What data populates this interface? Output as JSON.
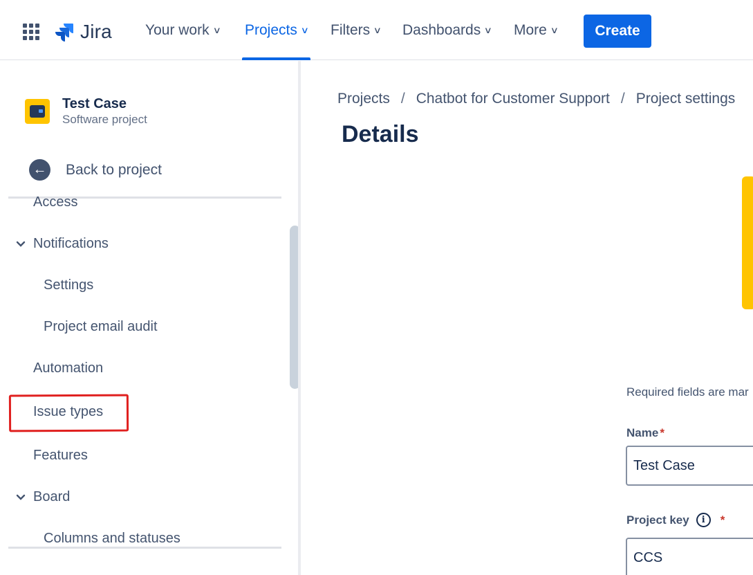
{
  "topnav": {
    "app_name": "Jira",
    "items": [
      {
        "label": "Your work",
        "active": false
      },
      {
        "label": "Projects",
        "active": true
      },
      {
        "label": "Filters",
        "active": false
      },
      {
        "label": "Dashboards",
        "active": false
      },
      {
        "label": "More",
        "active": false
      }
    ],
    "create_label": "Create",
    "colors": {
      "accent": "#0c66e4",
      "text": "#42526e"
    }
  },
  "sidebar": {
    "project_name": "Test Case",
    "project_type": "Software project",
    "back_label": "Back to project",
    "items": [
      {
        "label": "Access",
        "expandable": false
      },
      {
        "label": "Notifications",
        "expandable": true
      },
      {
        "label": "Settings",
        "expandable": false
      },
      {
        "label": "Project email audit",
        "expandable": false
      },
      {
        "label": "Automation",
        "expandable": false
      },
      {
        "label": "Issue types",
        "expandable": false,
        "highlighted": true
      },
      {
        "label": "Features",
        "expandable": false
      },
      {
        "label": "Board",
        "expandable": true
      },
      {
        "label": "Columns and statuses",
        "expandable": false
      }
    ]
  },
  "main": {
    "breadcrumb": [
      "Projects",
      "Chatbot for Customer Support",
      "Project settings"
    ],
    "breadcrumb_separator": "/",
    "title": "Details",
    "required_note": "Required fields are mar",
    "fields": {
      "name": {
        "label": "Name",
        "value": "Test Case",
        "required_mark": "*"
      },
      "project_key": {
        "label": "Project key",
        "value": "CCS",
        "required_mark": "*",
        "info_icon": "i"
      }
    }
  }
}
